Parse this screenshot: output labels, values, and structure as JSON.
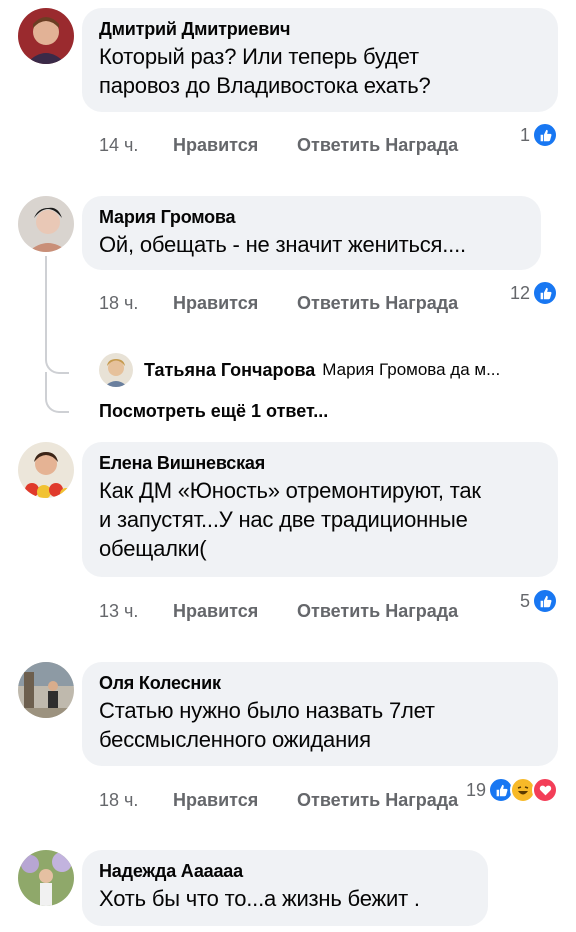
{
  "comments": [
    {
      "author": "Дмитрий Дмитриевич",
      "text_lines": [
        "Который раз? Или теперь будет",
        "паровоз до Владивостока ехать?"
      ],
      "time": "14 ч.",
      "like": "Нравится",
      "reply": "Ответить",
      "award": "Награда",
      "reaction_count": "1"
    },
    {
      "author": "Мария Громова",
      "text_lines": [
        "Ой, обещать  - не значит жениться...."
      ],
      "time": "18 ч.",
      "like": "Нравится",
      "reply": "Ответить",
      "award": "Награда",
      "reaction_count": "12"
    },
    {
      "author": "Елена Вишневская",
      "text_lines": [
        "Как ДМ «Юность» отремонтируют, так",
        "и запустят...У нас две традиционные",
        "обещалки("
      ],
      "time": "13 ч.",
      "like": "Нравится",
      "reply": "Ответить",
      "award": "Награда",
      "reaction_count": "5"
    },
    {
      "author": "Оля Колесник",
      "text_lines": [
        "Статью нужно было назвать 7лет",
        "бессмысленного ожидания"
      ],
      "time": "18 ч.",
      "like": "Нравится",
      "reply": "Ответить",
      "award": "Награда",
      "reaction_count": "19"
    },
    {
      "author": "Надежда Аааааа",
      "text_lines": [
        "Хоть бы что то...а жизнь бежит ."
      ]
    }
  ],
  "reply_preview": {
    "author": "Татьяна Гончарова",
    "snippet": "Мария Громова да м..."
  },
  "more_replies": "Посмотреть ещё 1 ответ...",
  "colors": {
    "like": "#1877f2",
    "haha": "#f7b928",
    "love": "#f33e58",
    "bubble": "#f0f2f5"
  },
  "icons": {
    "like": "thumbs-up-icon",
    "haha": "laughing-face-icon",
    "love": "heart-icon"
  }
}
